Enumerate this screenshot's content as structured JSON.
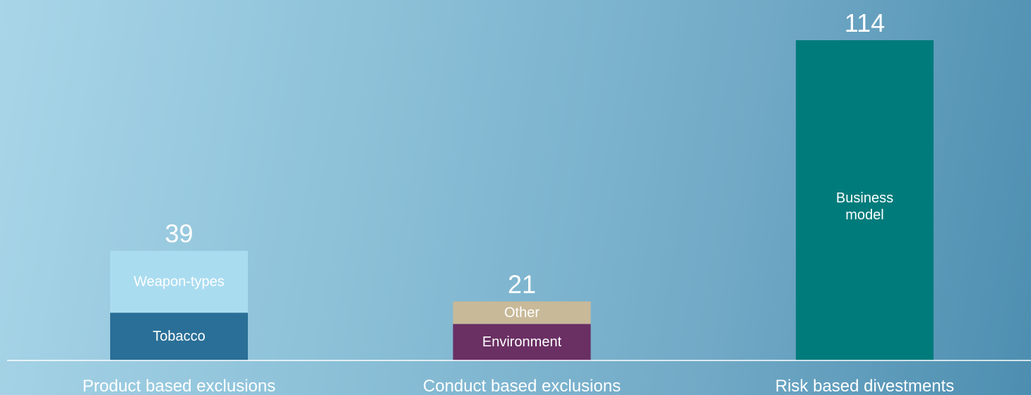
{
  "chart_data": {
    "type": "bar",
    "stacked": true,
    "categories": [
      "Product based exclusions",
      "Conduct based exclusions",
      "Risk based divestments"
    ],
    "totals": [
      39,
      21,
      114
    ],
    "segments": [
      [
        {
          "label": "Tobacco",
          "value": 17,
          "color": "#2a6f97",
          "text_color": "#ffffff"
        },
        {
          "label": "Weapon-types",
          "value": 22,
          "color": "#aadcf0",
          "text_color": "#ffffff"
        }
      ],
      [
        {
          "label": "Environment",
          "value": 13,
          "color": "#6a2f63",
          "text_color": "#ffffff"
        },
        {
          "label": "Other",
          "value": 8,
          "color": "#c8b998",
          "text_color": "#ffffff"
        }
      ],
      [
        {
          "label": "Business\nmodel",
          "value": 114,
          "color": "#007b7b",
          "text_color": "#ffffff"
        }
      ]
    ],
    "ylim": [
      0,
      114
    ],
    "grid": false,
    "legend": "none",
    "title": "",
    "xlabel": "",
    "ylabel": ""
  },
  "colors": {
    "baseline": "#ffffff",
    "labels": "#ffffff"
  }
}
